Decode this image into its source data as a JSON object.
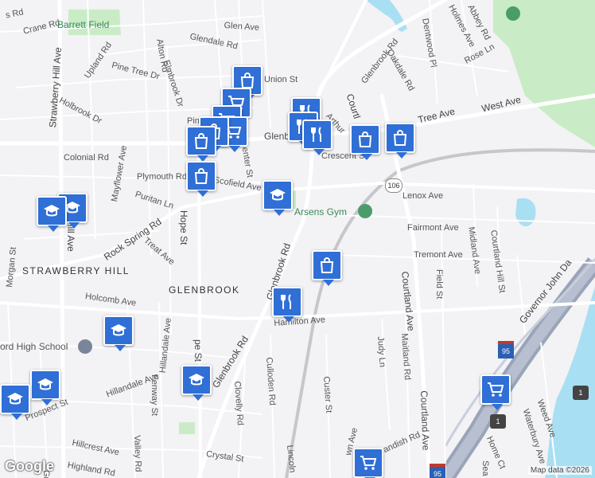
{
  "map": {
    "streets": [
      {
        "id": "crane-rd",
        "text": "Crane Rd"
      },
      {
        "id": "s-rd",
        "text": "s Rd"
      },
      {
        "id": "glen-ave",
        "text": "Glen Ave"
      },
      {
        "id": "glendale-rd",
        "text": "Glendale Rd"
      },
      {
        "id": "alton-rd",
        "text": "Alton Rd"
      },
      {
        "id": "elmbrook-dr",
        "text": "Elmbrook Dr"
      },
      {
        "id": "pine-tree-dr",
        "text": "Pine Tree Dr"
      },
      {
        "id": "upland-rd",
        "text": "Upland Rd"
      },
      {
        "id": "holbrook-dr",
        "text": "Holbrook Dr"
      },
      {
        "id": "union-st",
        "text": "Union St"
      },
      {
        "id": "glenbrook-rd-north",
        "text": "Glenbrook Rd"
      },
      {
        "id": "oakdale-rd",
        "text": "Oakdale Rd"
      },
      {
        "id": "dentwood-pl",
        "text": "Dentwood Pl"
      },
      {
        "id": "holmes-ave",
        "text": "Holmes Ave"
      },
      {
        "id": "abbey-rd",
        "text": "Abbey Rd"
      },
      {
        "id": "rose-ln",
        "text": "Rose Ln"
      },
      {
        "id": "west-ave",
        "text": "West Ave"
      },
      {
        "id": "tree-ave",
        "text": "Tree Ave"
      },
      {
        "id": "courtland-north",
        "text": "Courtl"
      },
      {
        "id": "arthur",
        "text": "Arthur"
      },
      {
        "id": "pin-st",
        "text": "Pin"
      },
      {
        "id": "colonial-rd",
        "text": "Colonial Rd"
      },
      {
        "id": "center-st",
        "text": "Center St"
      },
      {
        "id": "glenb-mid",
        "text": "Glenb"
      },
      {
        "id": "crescent-st",
        "text": "Crescent St"
      },
      {
        "id": "plymouth-rd",
        "text": "Plymouth Rd"
      },
      {
        "id": "scofield-ave",
        "text": "Scofield Ave"
      },
      {
        "id": "puritan-ln",
        "text": "Puritan Ln"
      },
      {
        "id": "lenox-ave",
        "text": "Lenox Ave"
      },
      {
        "id": "rock-spring-rd",
        "text": "Rock Spring Rd"
      },
      {
        "id": "mayflower-ave",
        "text": "Mayflower Ave"
      },
      {
        "id": "treat-ave",
        "text": "Treat Ave"
      },
      {
        "id": "hope-st",
        "text": "Hope St"
      },
      {
        "id": "fairmont-ave",
        "text": "Fairmont Ave"
      },
      {
        "id": "midland-ave",
        "text": "Midland Ave"
      },
      {
        "id": "courtland-hill-st",
        "text": "Courtland Hill St"
      },
      {
        "id": "tremont-ave",
        "text": "Tremont Ave"
      },
      {
        "id": "field-st",
        "text": "Field St"
      },
      {
        "id": "glenbrook-rd-mid",
        "text": "Glenbrook Rd"
      },
      {
        "id": "courtland-ave-mid",
        "text": "Courtland Ave"
      },
      {
        "id": "strawberry-hill-ave",
        "text": "Strawberry Hill Ave"
      },
      {
        "id": "hill-ave",
        "text": "Hill Ave"
      },
      {
        "id": "holcomb-ave",
        "text": "Holcomb Ave"
      },
      {
        "id": "hamilton-ave",
        "text": "Hamilton Ave"
      },
      {
        "id": "hillandale-ave-v",
        "text": "Hillandale Ave"
      },
      {
        "id": "morgan-st",
        "text": "Morgan St"
      },
      {
        "id": "judy-ln",
        "text": "Judy Ln"
      },
      {
        "id": "maitland-rd",
        "text": "Maitland Rd"
      },
      {
        "id": "custer-st",
        "text": "Custer St"
      },
      {
        "id": "culloden-rd",
        "text": "Culloden Rd"
      },
      {
        "id": "clovelly-rd",
        "text": "Clovelly Rd"
      },
      {
        "id": "glenbrook-rd-south",
        "text": "Glenbrook Rd"
      },
      {
        "id": "pe-st",
        "text": "pe St"
      },
      {
        "id": "hillandale-ave-h",
        "text": "Hillandale Ave"
      },
      {
        "id": "fenway-st",
        "text": "Fenway St"
      },
      {
        "id": "prospect-st",
        "text": "Prospect St"
      },
      {
        "id": "hillcrest-ave",
        "text": "Hillcrest Ave"
      },
      {
        "id": "valley-rd",
        "text": "Valley Rd"
      },
      {
        "id": "highland-rd",
        "text": "Highland Rd"
      },
      {
        "id": "crystal-st",
        "text": "Crystal St"
      },
      {
        "id": "lincoln",
        "text": "Lincoln"
      },
      {
        "id": "courtland-ave-south",
        "text": "Courtland Ave"
      },
      {
        "id": "wn-ave",
        "text": "wn Ave"
      },
      {
        "id": "andish-rd",
        "text": "andish Rd"
      },
      {
        "id": "weed-ave",
        "text": "Weed Ave"
      },
      {
        "id": "waterbury-ave",
        "text": "Waterbury Ave"
      },
      {
        "id": "home-ct",
        "text": "Home Ct"
      },
      {
        "id": "sea",
        "text": "Sea"
      },
      {
        "id": "gro",
        "text": "Gro"
      },
      {
        "id": "governor-john-da",
        "text": "Governor John Da"
      }
    ],
    "areas": [
      {
        "id": "strawberry-hill",
        "text": "STRAWBERRY HILL"
      },
      {
        "id": "glenbrook",
        "text": "GLENBROOK"
      }
    ],
    "places": [
      {
        "id": "barrett-field",
        "text": "Barrett Field"
      },
      {
        "id": "arsens-gym",
        "text": "Arsens Gym"
      },
      {
        "id": "high-school",
        "text": "ord High School"
      }
    ],
    "shields": [
      {
        "id": "route-106",
        "text": "106"
      },
      {
        "id": "i95-a",
        "text": "95"
      },
      {
        "id": "i95-b",
        "text": "95"
      },
      {
        "id": "us1-a",
        "text": "1"
      },
      {
        "id": "us1-b",
        "text": "1"
      }
    ],
    "markers": [
      {
        "id": "m1",
        "icon": "shopping-bag"
      },
      {
        "id": "m2",
        "icon": "shopping-cart"
      },
      {
        "id": "m3",
        "icon": "shopping-cart"
      },
      {
        "id": "m4",
        "icon": "shopping-cart"
      },
      {
        "id": "m5",
        "icon": "shopping-bag"
      },
      {
        "id": "m6",
        "icon": "shopping-bag"
      },
      {
        "id": "m7",
        "icon": "restaurant"
      },
      {
        "id": "m8",
        "icon": "restaurant"
      },
      {
        "id": "m9",
        "icon": "restaurant"
      },
      {
        "id": "m10",
        "icon": "shopping-bag"
      },
      {
        "id": "m11",
        "icon": "shopping-bag"
      },
      {
        "id": "m12",
        "icon": "shopping-bag"
      },
      {
        "id": "m13",
        "icon": "school"
      },
      {
        "id": "m14",
        "icon": "school"
      },
      {
        "id": "m15",
        "icon": "school"
      },
      {
        "id": "m16",
        "icon": "shopping-bag"
      },
      {
        "id": "m17",
        "icon": "restaurant"
      },
      {
        "id": "m18",
        "icon": "school"
      },
      {
        "id": "m19",
        "icon": "school"
      },
      {
        "id": "m20",
        "icon": "school"
      },
      {
        "id": "m21",
        "icon": "school"
      },
      {
        "id": "m22",
        "icon": "shopping-cart"
      },
      {
        "id": "m23",
        "icon": "shopping-cart"
      }
    ],
    "attribution": {
      "logo": "Google",
      "credit": "Map data ©2026"
    },
    "colors": {
      "background": "#f3f2f4",
      "park": "#c9ecc6",
      "water": "#a8dff3",
      "highway": "#9aa4b8",
      "marker": "#2f6fd6"
    }
  }
}
